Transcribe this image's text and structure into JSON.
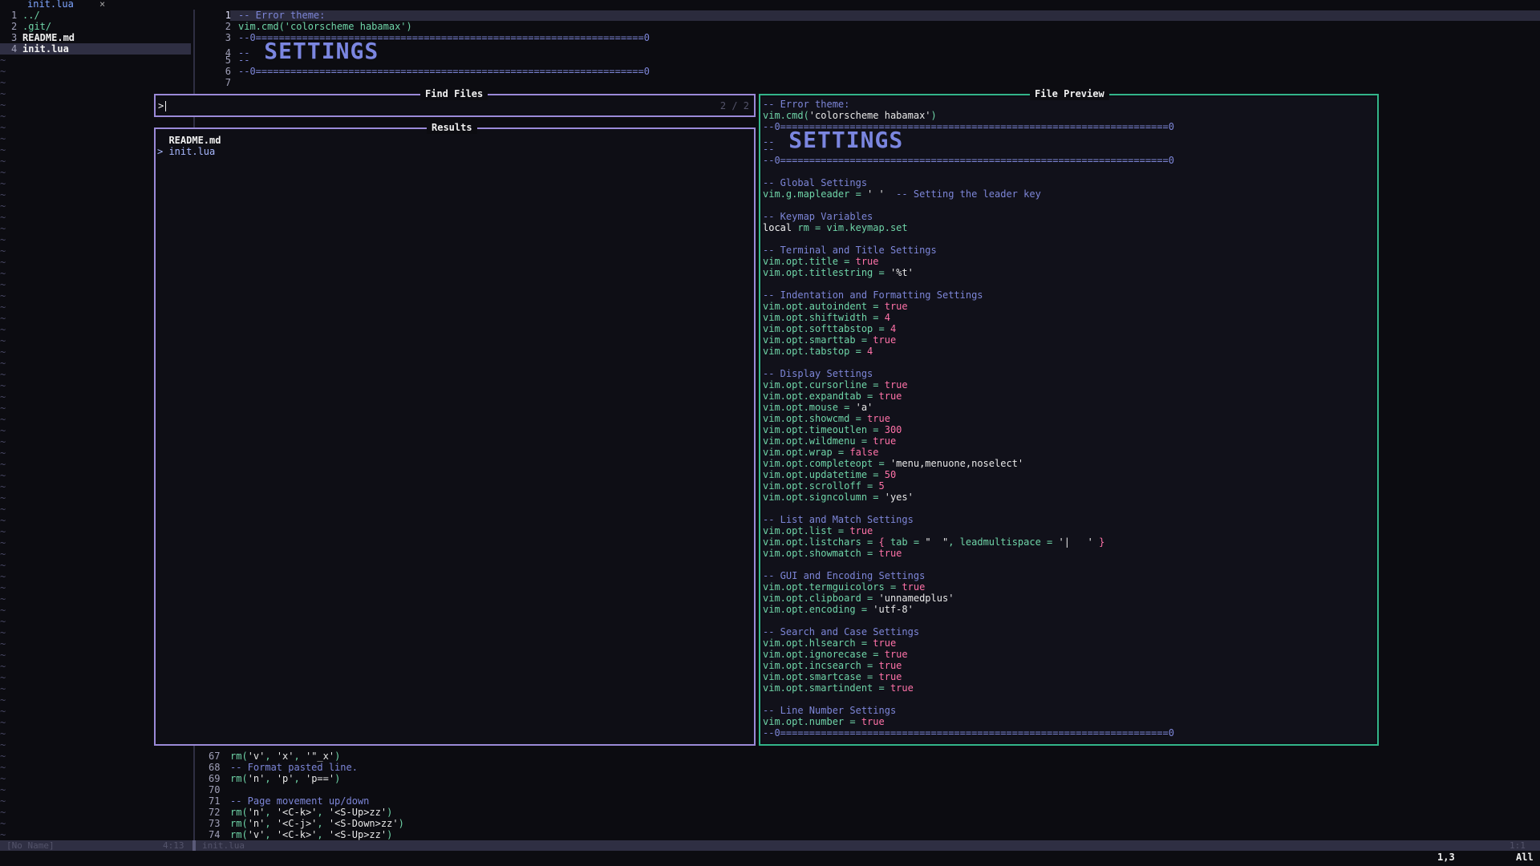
{
  "tabline": {
    "active_tab": "init.lua",
    "close": "×"
  },
  "tree": {
    "items": [
      {
        "num": "1",
        "label": "../",
        "color": "#6fd5a8"
      },
      {
        "num": "2",
        "label": ".git/",
        "color": "#6fd5a8"
      },
      {
        "num": "3",
        "label": "README.md",
        "color": "#f0f0f0"
      },
      {
        "num": "4",
        "label": "init.lua",
        "color": "#f0f0f0"
      }
    ],
    "tilde": "~"
  },
  "editor_top": [
    {
      "n": "1",
      "text": "-- Error theme:"
    },
    {
      "n": "2",
      "text": "vim.cmd('colorscheme habamax')"
    },
    {
      "n": "3",
      "text": "--0===================================================================0"
    },
    {
      "n": "4",
      "text": "--"
    },
    {
      "n": "5",
      "text": "--"
    },
    {
      "n": "6",
      "text": "--0===================================================================0"
    },
    {
      "n": "7",
      "text": ""
    }
  ],
  "banner_text": "SETTINGS",
  "find_files": {
    "title": "Find Files",
    "prompt": ">",
    "count": "2 / 2"
  },
  "results": {
    "title": "Results",
    "items": [
      {
        "prefix": "  ",
        "label": "README.md"
      },
      {
        "prefix": "> ",
        "label": "init.lua"
      }
    ]
  },
  "preview": {
    "title": "File Preview",
    "lines": [
      [
        {
          "t": "-- Error theme:",
          "c": "cmt"
        }
      ],
      [
        {
          "t": "vim.cmd(",
          "c": "ok"
        },
        {
          "t": "'colorscheme habamax'",
          "c": "str"
        },
        {
          "t": ")",
          "c": "ok"
        }
      ],
      [
        {
          "t": "--0===================================================================0",
          "c": "cmt"
        }
      ],
      [
        {
          "t": "--",
          "c": "cmt"
        }
      ],
      [
        {
          "t": "--",
          "c": "cmt"
        }
      ],
      [
        {
          "t": "--0===================================================================0",
          "c": "cmt"
        }
      ],
      [
        {
          "t": "",
          "c": ""
        }
      ],
      [
        {
          "t": "-- Global Settings",
          "c": "cmt"
        }
      ],
      [
        {
          "t": "vim.g.mapleader = ",
          "c": "ok"
        },
        {
          "t": "' '",
          "c": "str"
        },
        {
          "t": "  -- Setting the leader key",
          "c": "cmt"
        }
      ],
      [
        {
          "t": "",
          "c": ""
        }
      ],
      [
        {
          "t": "-- Keymap Variables",
          "c": "cmt"
        }
      ],
      [
        {
          "t": "local",
          "c": "kw"
        },
        {
          "t": " rm = vim.keymap.set",
          "c": "ok"
        }
      ],
      [
        {
          "t": "",
          "c": ""
        }
      ],
      [
        {
          "t": "-- Terminal and Title Settings",
          "c": "cmt"
        }
      ],
      [
        {
          "t": "vim.opt.title = ",
          "c": "ok"
        },
        {
          "t": "true",
          "c": "mag"
        }
      ],
      [
        {
          "t": "vim.opt.titlestring = ",
          "c": "ok"
        },
        {
          "t": "'%t'",
          "c": "str"
        }
      ],
      [
        {
          "t": "",
          "c": ""
        }
      ],
      [
        {
          "t": "-- Indentation and Formatting Settings",
          "c": "cmt"
        }
      ],
      [
        {
          "t": "vim.opt.autoindent = ",
          "c": "ok"
        },
        {
          "t": "true",
          "c": "mag"
        }
      ],
      [
        {
          "t": "vim.opt.shiftwidth = ",
          "c": "ok"
        },
        {
          "t": "4",
          "c": "mag"
        }
      ],
      [
        {
          "t": "vim.opt.softtabstop = ",
          "c": "ok"
        },
        {
          "t": "4",
          "c": "mag"
        }
      ],
      [
        {
          "t": "vim.opt.smarttab = ",
          "c": "ok"
        },
        {
          "t": "true",
          "c": "mag"
        }
      ],
      [
        {
          "t": "vim.opt.tabstop = ",
          "c": "ok"
        },
        {
          "t": "4",
          "c": "mag"
        }
      ],
      [
        {
          "t": "",
          "c": ""
        }
      ],
      [
        {
          "t": "-- Display Settings",
          "c": "cmt"
        }
      ],
      [
        {
          "t": "vim.opt.cursorline = ",
          "c": "ok"
        },
        {
          "t": "true",
          "c": "mag"
        }
      ],
      [
        {
          "t": "vim.opt.expandtab = ",
          "c": "ok"
        },
        {
          "t": "true",
          "c": "mag"
        }
      ],
      [
        {
          "t": "vim.opt.mouse = ",
          "c": "ok"
        },
        {
          "t": "'a'",
          "c": "str"
        }
      ],
      [
        {
          "t": "vim.opt.showcmd = ",
          "c": "ok"
        },
        {
          "t": "true",
          "c": "mag"
        }
      ],
      [
        {
          "t": "vim.opt.timeoutlen = ",
          "c": "ok"
        },
        {
          "t": "300",
          "c": "mag"
        }
      ],
      [
        {
          "t": "vim.opt.wildmenu = ",
          "c": "ok"
        },
        {
          "t": "true",
          "c": "mag"
        }
      ],
      [
        {
          "t": "vim.opt.wrap = ",
          "c": "ok"
        },
        {
          "t": "false",
          "c": "mag"
        }
      ],
      [
        {
          "t": "vim.opt.completeopt = ",
          "c": "ok"
        },
        {
          "t": "'menu,menuone,noselect'",
          "c": "str"
        }
      ],
      [
        {
          "t": "vim.opt.updatetime = ",
          "c": "ok"
        },
        {
          "t": "50",
          "c": "mag"
        }
      ],
      [
        {
          "t": "vim.opt.scrolloff = ",
          "c": "ok"
        },
        {
          "t": "5",
          "c": "mag"
        }
      ],
      [
        {
          "t": "vim.opt.signcolumn = ",
          "c": "ok"
        },
        {
          "t": "'yes'",
          "c": "str"
        }
      ],
      [
        {
          "t": "",
          "c": ""
        }
      ],
      [
        {
          "t": "-- List and Match Settings",
          "c": "cmt"
        }
      ],
      [
        {
          "t": "vim.opt.list = ",
          "c": "ok"
        },
        {
          "t": "true",
          "c": "mag"
        }
      ],
      [
        {
          "t": "vim.opt.listchars = ",
          "c": "ok"
        },
        {
          "t": "{",
          "c": "mag"
        },
        {
          "t": " tab = ",
          "c": "ok"
        },
        {
          "t": "\"  \"",
          "c": "str"
        },
        {
          "t": ", leadmultispace = ",
          "c": "ok"
        },
        {
          "t": "'|   '",
          "c": "str"
        },
        {
          "t": " }",
          "c": "mag"
        }
      ],
      [
        {
          "t": "vim.opt.showmatch = ",
          "c": "ok"
        },
        {
          "t": "true",
          "c": "mag"
        }
      ],
      [
        {
          "t": "",
          "c": ""
        }
      ],
      [
        {
          "t": "-- GUI and Encoding Settings",
          "c": "cmt"
        }
      ],
      [
        {
          "t": "vim.opt.termguicolors = ",
          "c": "ok"
        },
        {
          "t": "true",
          "c": "mag"
        }
      ],
      [
        {
          "t": "vim.opt.clipboard = ",
          "c": "ok"
        },
        {
          "t": "'unnamedplus'",
          "c": "str"
        }
      ],
      [
        {
          "t": "vim.opt.encoding = ",
          "c": "ok"
        },
        {
          "t": "'utf-8'",
          "c": "str"
        }
      ],
      [
        {
          "t": "",
          "c": ""
        }
      ],
      [
        {
          "t": "-- Search and Case Settings",
          "c": "cmt"
        }
      ],
      [
        {
          "t": "vim.opt.hlsearch = ",
          "c": "ok"
        },
        {
          "t": "true",
          "c": "mag"
        }
      ],
      [
        {
          "t": "vim.opt.ignorecase = ",
          "c": "ok"
        },
        {
          "t": "true",
          "c": "mag"
        }
      ],
      [
        {
          "t": "vim.opt.incsearch = ",
          "c": "ok"
        },
        {
          "t": "true",
          "c": "mag"
        }
      ],
      [
        {
          "t": "vim.opt.smartcase = ",
          "c": "ok"
        },
        {
          "t": "true",
          "c": "mag"
        }
      ],
      [
        {
          "t": "vim.opt.smartindent = ",
          "c": "ok"
        },
        {
          "t": "true",
          "c": "mag"
        }
      ],
      [
        {
          "t": "",
          "c": ""
        }
      ],
      [
        {
          "t": "-- Line Number Settings",
          "c": "cmt"
        }
      ],
      [
        {
          "t": "vim.opt.number = ",
          "c": "ok"
        },
        {
          "t": "true",
          "c": "mag"
        }
      ],
      [
        {
          "t": "--0===================================================================0",
          "c": "cmt"
        }
      ]
    ]
  },
  "editor_bottom": [
    [
      {
        "t": "67 ",
        "c": "ln"
      },
      {
        "t": "rm(",
        "c": "ok"
      },
      {
        "t": "'v'",
        "c": "str"
      },
      {
        "t": ", ",
        "c": "ok"
      },
      {
        "t": "'x'",
        "c": "str"
      },
      {
        "t": ", ",
        "c": "ok"
      },
      {
        "t": "'\"_x'",
        "c": "str"
      },
      {
        "t": ")",
        "c": "ok"
      }
    ],
    [
      {
        "t": "68 ",
        "c": "ln"
      },
      {
        "t": "-- Format pasted line.",
        "c": "cmt"
      }
    ],
    [
      {
        "t": "69 ",
        "c": "ln"
      },
      {
        "t": "rm(",
        "c": "ok"
      },
      {
        "t": "'n'",
        "c": "str"
      },
      {
        "t": ", ",
        "c": "ok"
      },
      {
        "t": "'p'",
        "c": "str"
      },
      {
        "t": ", ",
        "c": "ok"
      },
      {
        "t": "'p=='",
        "c": "str"
      },
      {
        "t": ")",
        "c": "ok"
      }
    ],
    [
      {
        "t": "70 ",
        "c": "ln"
      }
    ],
    [
      {
        "t": "71 ",
        "c": "ln"
      },
      {
        "t": "-- Page movement up/down",
        "c": "cmt"
      }
    ],
    [
      {
        "t": "72 ",
        "c": "ln"
      },
      {
        "t": "rm(",
        "c": "ok"
      },
      {
        "t": "'n'",
        "c": "str"
      },
      {
        "t": ", ",
        "c": "ok"
      },
      {
        "t": "'<C-k>'",
        "c": "str"
      },
      {
        "t": ", ",
        "c": "ok"
      },
      {
        "t": "'<S-Up>zz'",
        "c": "str"
      },
      {
        "t": ")",
        "c": "ok"
      }
    ],
    [
      {
        "t": "73 ",
        "c": "ln"
      },
      {
        "t": "rm(",
        "c": "ok"
      },
      {
        "t": "'n'",
        "c": "str"
      },
      {
        "t": ", ",
        "c": "ok"
      },
      {
        "t": "'<C-j>'",
        "c": "str"
      },
      {
        "t": ", ",
        "c": "ok"
      },
      {
        "t": "'<S-Down>zz'",
        "c": "str"
      },
      {
        "t": ")",
        "c": "ok"
      }
    ],
    [
      {
        "t": "74 ",
        "c": "ln"
      },
      {
        "t": "rm(",
        "c": "ok"
      },
      {
        "t": "'v'",
        "c": "str"
      },
      {
        "t": ", ",
        "c": "ok"
      },
      {
        "t": "'<C-k>'",
        "c": "str"
      },
      {
        "t": ", ",
        "c": "ok"
      },
      {
        "t": "'<S-Up>zz'",
        "c": "str"
      },
      {
        "t": ")",
        "c": "ok"
      }
    ]
  ],
  "status": {
    "left_buf": "[No Name]",
    "left_pos": "4:13",
    "right_buf": "init.lua",
    "right_pos": "1:1"
  },
  "cmdline": {
    "pos": "1,3",
    "scroll": "All"
  },
  "colors": {
    "accent_find": "#9b8ad8",
    "accent_preview": "#33b48a",
    "comment": "#7d86d8",
    "keyword_green": "#6fd5a8",
    "value_pink": "#ff72a8"
  }
}
